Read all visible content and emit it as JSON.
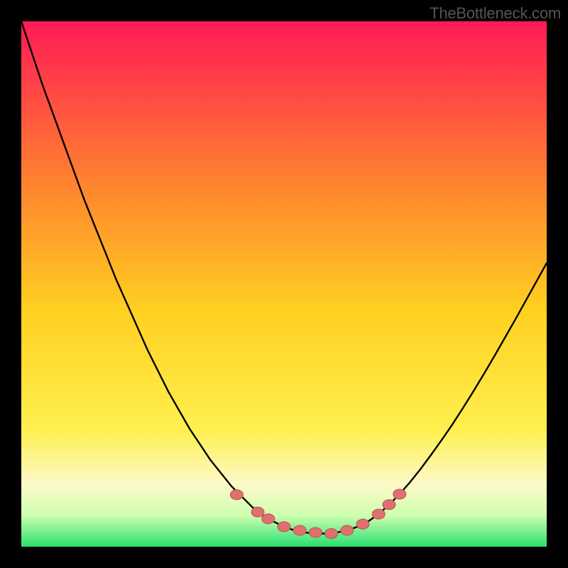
{
  "watermark": "TheBottleneck.com",
  "palette": {
    "black": "#000000",
    "curve_stroke": "#000000",
    "marker_fill": "#e07070",
    "marker_stroke": "#c05050",
    "bottom_band": "#28e070",
    "bottom_band_top": "#d0ffb0",
    "pale_band": "#fcf9c8",
    "grad_top": "#ff1a55",
    "grad_mid_high": "#ff8030",
    "grad_mid": "#ffd020",
    "grad_low": "#fff050"
  },
  "chart_data": {
    "type": "line",
    "title": "",
    "xlabel": "",
    "ylabel": "",
    "xlim": [
      0,
      100
    ],
    "ylim": [
      0,
      100
    ],
    "x": [
      0,
      2,
      4,
      6,
      8,
      10,
      12,
      14,
      16,
      18,
      20,
      22,
      24,
      26,
      28,
      30,
      32,
      34,
      36,
      38,
      40,
      42,
      44,
      46,
      48,
      50,
      52,
      54,
      56,
      58,
      60,
      62,
      64,
      66,
      68,
      70,
      72,
      74,
      76,
      78,
      80,
      82,
      84,
      86,
      88,
      90,
      92,
      94,
      96,
      98,
      100
    ],
    "values": [
      100,
      94,
      88,
      82.5,
      77,
      71.5,
      66,
      61,
      56,
      51,
      46.5,
      42,
      37.5,
      33.5,
      29.5,
      26,
      22.5,
      19.5,
      16.5,
      14,
      11.5,
      9.5,
      7.5,
      6,
      4.8,
      3.8,
      3.1,
      2.7,
      2.5,
      2.5,
      2.7,
      3.1,
      3.8,
      4.8,
      6.2,
      8,
      10,
      12.3,
      14.8,
      17.5,
      20.3,
      23.2,
      26.3,
      29.5,
      32.8,
      36.2,
      39.7,
      43.2,
      46.8,
      50.4,
      54
    ],
    "markers": [
      {
        "x": 41,
        "y": 9.9
      },
      {
        "x": 45,
        "y": 6.6
      },
      {
        "x": 47,
        "y": 5.3
      },
      {
        "x": 50,
        "y": 3.8
      },
      {
        "x": 53,
        "y": 3.1
      },
      {
        "x": 56,
        "y": 2.7
      },
      {
        "x": 59,
        "y": 2.5
      },
      {
        "x": 62,
        "y": 3.1
      },
      {
        "x": 65,
        "y": 4.3
      },
      {
        "x": 68,
        "y": 6.2
      },
      {
        "x": 70,
        "y": 8
      },
      {
        "x": 72,
        "y": 10
      }
    ]
  }
}
